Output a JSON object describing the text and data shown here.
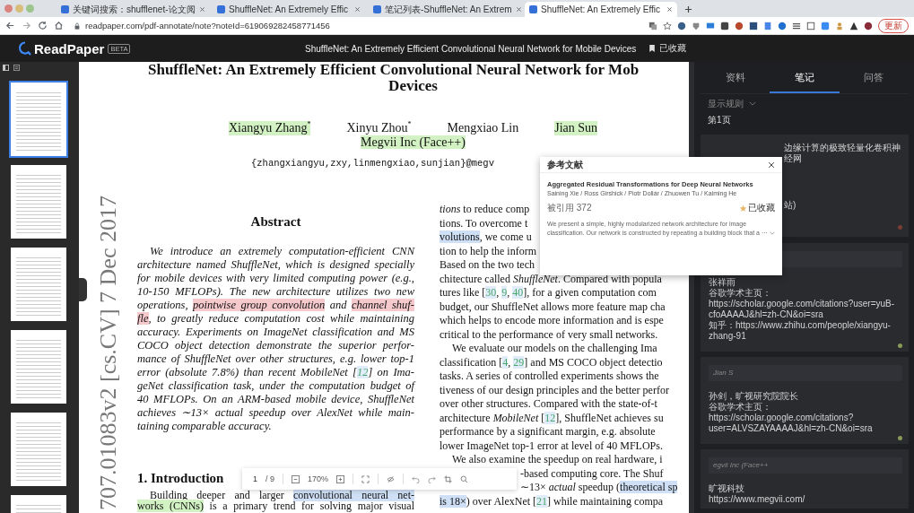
{
  "browser": {
    "tabs": [
      {
        "title": "关键词搜索：shufflenet-论文阅",
        "selected": false
      },
      {
        "title": "ShuffleNet: An Extremely Effic",
        "selected": false
      },
      {
        "title": "笔记列表-ShuffleNet: An Extrem",
        "selected": false
      },
      {
        "title": "ShuffleNet: An Extremely Effic",
        "selected": true
      }
    ],
    "address": "readpaper.com/pdf-annotate/note?noteId=619069282458771456",
    "update_button": "更新"
  },
  "header": {
    "logo": "ReadPaper",
    "badge": "BETA",
    "title": "ShuffleNet: An Extremely Efficient Convolutional Neural Network for Mobile Devices",
    "bookmark": "已收藏"
  },
  "thumbnails": [
    {
      "selected": true
    },
    {
      "selected": false
    },
    {
      "selected": false
    },
    {
      "selected": false
    },
    {
      "selected": false
    },
    {
      "selected": false
    }
  ],
  "paper": {
    "title_lines": [
      "ShuffleNet: An Extremely Efficient Convolutional Neural Network for Mob",
      "Devices"
    ],
    "authors": [
      {
        "name": "Xiangyu Zhang$^{*}$",
        "color": "#d3f2c4"
      },
      {
        "name": "Xinyu Zhou$^{*}$"
      },
      {
        "name": "Mengxiao Lin"
      },
      {
        "name": "Jian Sun",
        "color": "#d3f2c4"
      }
    ],
    "affiliation": {
      "text": "Megvii Inc (Face++)",
      "color": "#d3f2c4"
    },
    "emails": "{zhangxiangyu,zxy,linmengxiao,sunjian}@megv",
    "stamp": "707.01083v2 [cs.CV] 7 Dec 2017",
    "left_column": [
      {
        "kind": "heading",
        "text": "Abstract"
      },
      {
        "kind": "abstract",
        "lines": [
          {
            "segs": [
              {
                "t": "We introduce an extremely computation-efficient CNN"
              }
            ],
            "indent": true
          },
          {
            "segs": [
              {
                "t": "architecture named ShuffleNet, which is designed specially"
              }
            ],
            "indent": false
          },
          {
            "segs": [
              {
                "t": "for mobile devices with very limited computing power (e.g.,"
              }
            ],
            "indent": false
          },
          {
            "segs": [
              {
                "t": "10-150 MFLOPs). The new architecture utilizes two new"
              }
            ],
            "indent": false
          },
          {
            "segs": [
              {
                "t": "operations, "
              },
              {
                "t": "pointwise group convolution",
                "color": "#f6c9cc"
              },
              {
                "t": " and "
              },
              {
                "t": "channel shuf-",
                "color": "#f6c9cc"
              }
            ],
            "indent": false
          },
          {
            "segs": [
              {
                "t": "fle",
                "color": "#f6c9cc"
              },
              {
                "t": ", to greatly reduce computation cost while maintaining"
              }
            ],
            "indent": false
          },
          {
            "segs": [
              {
                "t": "accuracy. Experiments on ImageNet classification and MS"
              }
            ],
            "indent": false
          },
          {
            "segs": [
              {
                "t": "COCO object detection demonstrate the superior perfor-"
              }
            ],
            "indent": false
          },
          {
            "segs": [
              {
                "t": "mance of ShuffleNet over other structures, e.g. lower top-1"
              }
            ],
            "indent": false
          },
          {
            "segs": [
              {
                "t": "error (absolute 7.8%) than recent MobileNet ["
              },
              {
                "t": "12",
                "kind": "cite"
              },
              {
                "t": "] on Ima-"
              }
            ],
            "indent": false
          },
          {
            "segs": [
              {
                "t": "geNet classification task, under the computation budget of"
              }
            ],
            "indent": false
          },
          {
            "segs": [
              {
                "t": "40 MFLOPs. On an ARM-based mobile device, ShuffleNet"
              }
            ],
            "indent": false
          },
          {
            "segs": [
              {
                "t": "achieves ∼13× actual speedup over AlexNet while main-"
              }
            ],
            "indent": false
          },
          {
            "segs": [
              {
                "t": "taining comparable accuracy."
              }
            ],
            "indent": false
          }
        ]
      },
      {
        "kind": "heading",
        "text": "1. Introduction"
      },
      {
        "kind": "body",
        "lines": [
          {
            "segs": [
              {
                "t": "Building deeper and larger "
              },
              {
                "t": "convolutional neural net-",
                "color": "#cfe0f6"
              }
            ],
            "indent": true
          },
          {
            "segs": [
              {
                "t": "works (CNNs)",
                "color": "#d3f2c4"
              },
              {
                "t": " is a primary trend for solving major visual"
              }
            ],
            "indent": false
          }
        ]
      }
    ],
    "right_column": [
      {
        "segs": [
          {
            "t": "*tions* to reduce comp"
          }
        ],
        "indent": false,
        "covered": false
      },
      {
        "segs": [
          {
            "t": "tions.  To overcome t"
          }
        ],
        "indent": false,
        "covered": false
      },
      {
        "segs": [
          {
            "t": "volutions",
            "color": "#cfe0f6"
          },
          {
            "t": ", we come u"
          }
        ],
        "indent": false,
        "covered": false
      },
      {
        "segs": [
          {
            "t": "tion to help the inform"
          }
        ],
        "indent": false,
        "covered": false
      },
      {
        "segs": [
          {
            "t": "Based on the two tech"
          }
        ],
        "indent": false,
        "covered": false
      },
      {
        "segs": [
          {
            "t": "chitecture called *ShuffleNet*. Compared with popula"
          }
        ],
        "indent": false,
        "covered": false
      },
      {
        "segs": [
          {
            "t": "tures like  ["
          },
          {
            "t": "30",
            "kind": "cite"
          },
          {
            "t": ", "
          },
          {
            "t": "9",
            "kind": "cite"
          },
          {
            "t": ", "
          },
          {
            "t": "40",
            "kind": "cite"
          },
          {
            "t": "], for a given computation com"
          }
        ],
        "indent": false,
        "covered": false
      },
      {
        "segs": [
          {
            "t": "budget, our ShuffleNet allows more feature map cha"
          }
        ],
        "indent": false,
        "covered": false
      },
      {
        "segs": [
          {
            "t": "which helps to encode more information and is espe"
          }
        ],
        "indent": false,
        "covered": false
      },
      {
        "segs": [
          {
            "t": "critical to the performance of very small networks."
          }
        ],
        "indent": false,
        "covered": false
      },
      {
        "segs": [
          {
            "t": "We evaluate our models on the challenging Ima"
          }
        ],
        "indent": true,
        "covered": false
      },
      {
        "segs": [
          {
            "t": "classification ["
          },
          {
            "t": "4",
            "kind": "cite"
          },
          {
            "t": ", "
          },
          {
            "t": "29",
            "kind": "cite"
          },
          {
            "t": "] and MS COCO object detectio"
          }
        ],
        "indent": false,
        "covered": false
      },
      {
        "segs": [
          {
            "t": "tasks.  A series of controlled experiments shows the"
          }
        ],
        "indent": false,
        "covered": false
      },
      {
        "segs": [
          {
            "t": "tiveness of our design principles and the better perfor"
          }
        ],
        "indent": false,
        "covered": false
      },
      {
        "segs": [
          {
            "t": "over other structures.  Compared with the state-of-t"
          }
        ],
        "indent": false,
        "covered": false
      },
      {
        "segs": [
          {
            "t": "architecture *MobileNet* ["
          },
          {
            "t": "12",
            "kind": "cite"
          },
          {
            "t": "], ShuffleNet achieves su"
          }
        ],
        "indent": false,
        "covered": false
      },
      {
        "segs": [
          {
            "t": "performance by a significant margin, e.g.  absolute"
          }
        ],
        "indent": false,
        "covered": false
      },
      {
        "segs": [
          {
            "t": "lower ImageNet top-1 error at level of 40 MFLOPs."
          }
        ],
        "indent": false,
        "covered": false
      },
      {
        "segs": [
          {
            "t": "We also examine the speedup on real hardware, i"
          }
        ],
        "indent": true,
        "covered": false
      },
      {
        "segs": [
          {
            "t": "-based computing core. The Shuf"
          }
        ],
        "indent": false,
        "covered": true
      },
      {
        "segs": [
          {
            "t": "∼13× *actual* speedup ("
          },
          {
            "t": "theoretical sp",
            "color": "#cfe0f6"
          }
        ],
        "indent": false,
        "covered": true
      },
      {
        "segs": [
          {
            "t": "is 18×",
            "color": "#cfe0f6"
          },
          {
            "t": ") over AlexNet ["
          },
          {
            "t": "21",
            "kind": "cite"
          },
          {
            "t": "] while maintaining compa"
          }
        ],
        "indent": false,
        "covered": false
      }
    ]
  },
  "toolbar": {
    "page": "1",
    "pages": "/ 9",
    "zoom": "170%"
  },
  "popup": {
    "heading": "参考文献",
    "title": "Aggregated Residual Transformations for Deep Neural Networks",
    "authors": "Saining Xie / Ross Girshick / Piotr Dollár / Zhuowen Tu / Kaiming He",
    "citations": "被引用 372",
    "saved": "已收藏",
    "abstract": "We present a simple, highly modularized network architecture for image classification. Our network is constructed by repeating a building block that a ···"
  },
  "panel": {
    "tabs": [
      {
        "label": "资料",
        "selected": false
      },
      {
        "label": "笔记",
        "selected": true
      },
      {
        "label": "问答",
        "selected": false
      }
    ],
    "filter": "显示规则",
    "page_label": "第1页",
    "notes": [
      {
        "kind": "covered",
        "lines": [
          "边缘计算的极致轻量化卷积神经网",
          "站)"
        ],
        "color": "#7b3e34"
      },
      {
        "kind": "quote",
        "lines": [
          "张祥雨",
          "谷歌学术主页：https://scholar.google.com/citations?user=yuB-cfoAAAAJ&hl=zh-CN&oi=sra",
          "知乎：https://www.zhihu.com/people/xiangyu-zhang-91"
        ],
        "color": "#8a9a58"
      },
      {
        "kind": "quote",
        "quote": "Jian S",
        "lines": [
          "孙剑，旷视研究院院长",
          "谷歌学术主页：https://scholar.google.com/citations?user=ALVSZAYAAAAJ&hl=zh-CN&oi=sra"
        ],
        "color": "#8a9a59"
      },
      {
        "kind": "quote",
        "quote": "egvii Inc (Face++",
        "lines": [
          "旷视科技",
          "https://www.megvii.com/"
        ]
      }
    ]
  }
}
